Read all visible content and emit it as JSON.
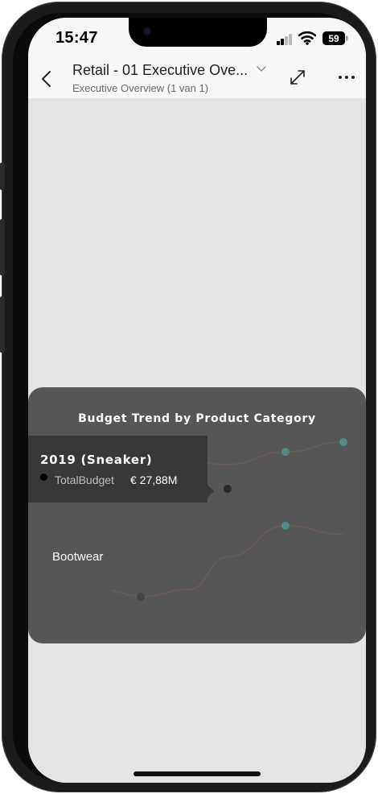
{
  "status_bar": {
    "time": "15:47",
    "battery": "59"
  },
  "header": {
    "title": "Retail - 01 Executive Ove...",
    "subtitle": "Executive Overview (1 van 1)"
  },
  "visual": {
    "title": "Budget Trend by Product Category",
    "series_label": "Bootwear",
    "tooltip": {
      "heading": "2019 (Sneaker)",
      "measure": "TotalBudget",
      "value": "€ 27,88M"
    },
    "colors": {
      "line": "#6a5a5a",
      "highlight": "#4f8a83",
      "overlay": "#565656",
      "canvas": "#e4e4e4"
    }
  },
  "chart_data": {
    "type": "line",
    "title": "Budget Trend by Product Category",
    "series": [
      {
        "name": "Sneaker",
        "points": [
          {
            "index": 0,
            "value": 0.7
          },
          {
            "index": 1,
            "value": 0.72
          },
          {
            "index": 2,
            "value": 0.68
          },
          {
            "index": 3,
            "value": 0.86
          },
          {
            "index": 4,
            "value": 1.0
          }
        ]
      },
      {
        "name": "Bootwear",
        "points": [
          {
            "index": 0,
            "value": 0.0
          },
          {
            "index": 1,
            "value": 0.1
          },
          {
            "index": 2,
            "value": 0.55
          },
          {
            "index": 3,
            "value": 0.98
          },
          {
            "index": 4,
            "value": 0.86
          }
        ]
      }
    ]
  }
}
